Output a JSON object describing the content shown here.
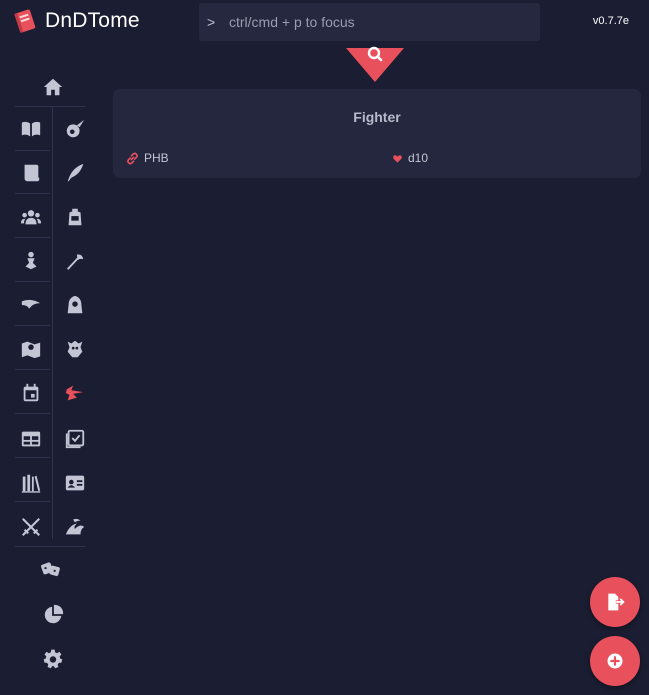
{
  "header": {
    "app_name": "DnDTome",
    "search_prompt": ">",
    "search_placeholder": "ctrl/cmd + p to focus",
    "version": "v0.7.7e"
  },
  "colors": {
    "accent": "#e8505b",
    "background": "#1b1e32",
    "card": "#24273d",
    "icon": "#c3c5d4"
  },
  "sidebar": {
    "items": [
      {
        "icon": "home-icon",
        "active": false
      },
      {
        "icon": "spellbook-icon",
        "active": false
      },
      {
        "icon": "fireball-icon",
        "active": false
      },
      {
        "icon": "scroll-icon",
        "active": false
      },
      {
        "icon": "quill-icon",
        "active": false
      },
      {
        "icon": "group-icon",
        "active": false
      },
      {
        "icon": "backpack-icon",
        "active": false
      },
      {
        "icon": "thief-icon",
        "active": false
      },
      {
        "icon": "axe-icon",
        "active": false
      },
      {
        "icon": "wind-icon",
        "active": false
      },
      {
        "icon": "hooded-figure-icon",
        "active": false
      },
      {
        "icon": "map-icon",
        "active": false
      },
      {
        "icon": "monster-icon",
        "active": false
      },
      {
        "icon": "calendar-icon",
        "active": false
      },
      {
        "icon": "class-icon",
        "active": true
      },
      {
        "icon": "table-icon",
        "active": false
      },
      {
        "icon": "checklist-icon",
        "active": false
      },
      {
        "icon": "library-icon",
        "active": false
      },
      {
        "icon": "id-card-icon",
        "active": false
      },
      {
        "icon": "crossed-swords-icon",
        "active": false
      },
      {
        "icon": "sea-creature-icon",
        "active": false
      },
      {
        "icon": "dice-icon",
        "active": false
      },
      {
        "icon": "pie-chart-icon",
        "active": false
      },
      {
        "icon": "gear-icon",
        "active": false
      }
    ]
  },
  "card": {
    "title": "Fighter",
    "source": "PHB",
    "source_icon": "link-icon",
    "hit_die": "d10",
    "hit_die_icon": "heart-icon"
  },
  "fabs": {
    "export_icon": "export-file-icon",
    "add_icon": "add-circle-icon"
  }
}
